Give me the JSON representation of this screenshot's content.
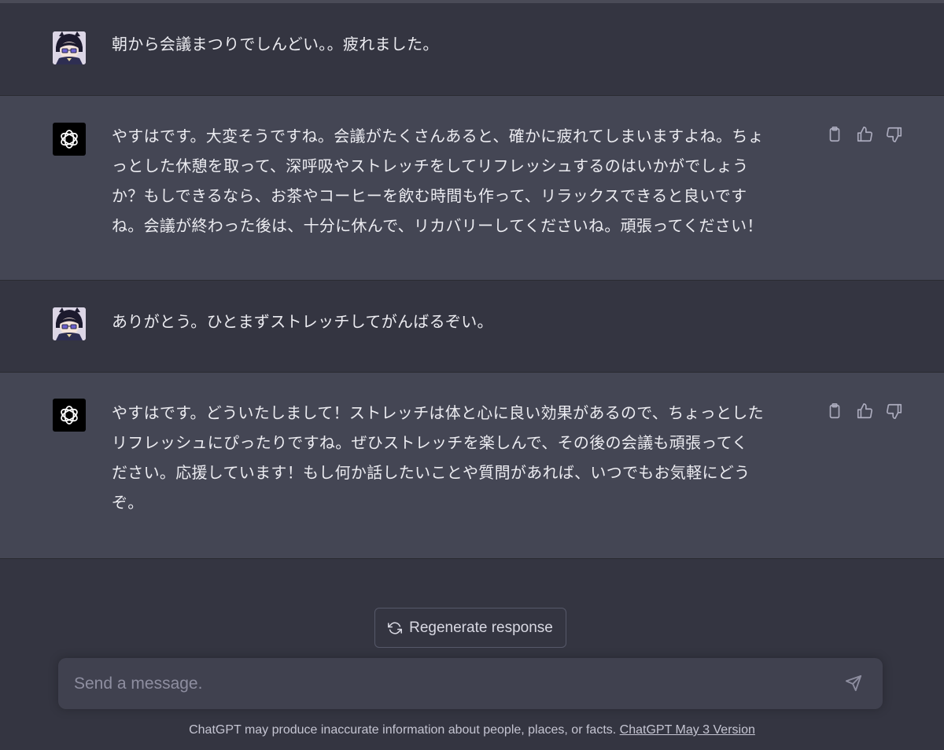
{
  "conversation": {
    "messages": [
      {
        "role": "user",
        "text": "朝から会議まつりでしんどい。。疲れました。"
      },
      {
        "role": "assistant",
        "lines": [
          "やすはです。大変そうですね。会議がたくさんあると、確かに疲れてしまいますよね。ちょ",
          "っとした休憩を取って、深呼吸やストレッチをしてリフレッシュするのはいかがでしょう",
          "か？もしできるなら、お茶やコーヒーを飲む時間も作って、リラックスできると良いです",
          "ね。会議が終わった後は、十分に休んで、リカバリーしてくださいね。頑張ってください！"
        ]
      },
      {
        "role": "user",
        "text": "ありがとう。ひとまずストレッチしてがんばるぞい。"
      },
      {
        "role": "assistant",
        "lines": [
          "やすはです。どういたしまして！ストレッチは体と心に良い効果があるので、ちょっとした",
          "リフレッシュにぴったりですね。ぜひストレッチを楽しんで、その後の会議も頑張ってく",
          "ださい。応援しています！もし何か話したいことや質問があれば、いつでもお気軽にどう",
          "ぞ。"
        ]
      }
    ]
  },
  "regenerate": {
    "label": "Regenerate response",
    "icon": "refresh-icon"
  },
  "composer": {
    "placeholder": "Send a message.",
    "value": "",
    "send_icon": "send-icon"
  },
  "footer": {
    "text": "ChatGPT may produce inaccurate information about people, places, or facts.",
    "link": "ChatGPT May 3 Version"
  },
  "colors": {
    "background": "#343541",
    "assistant_background": "#444654",
    "composer_background": "#40414f",
    "text": "#ececf1"
  }
}
